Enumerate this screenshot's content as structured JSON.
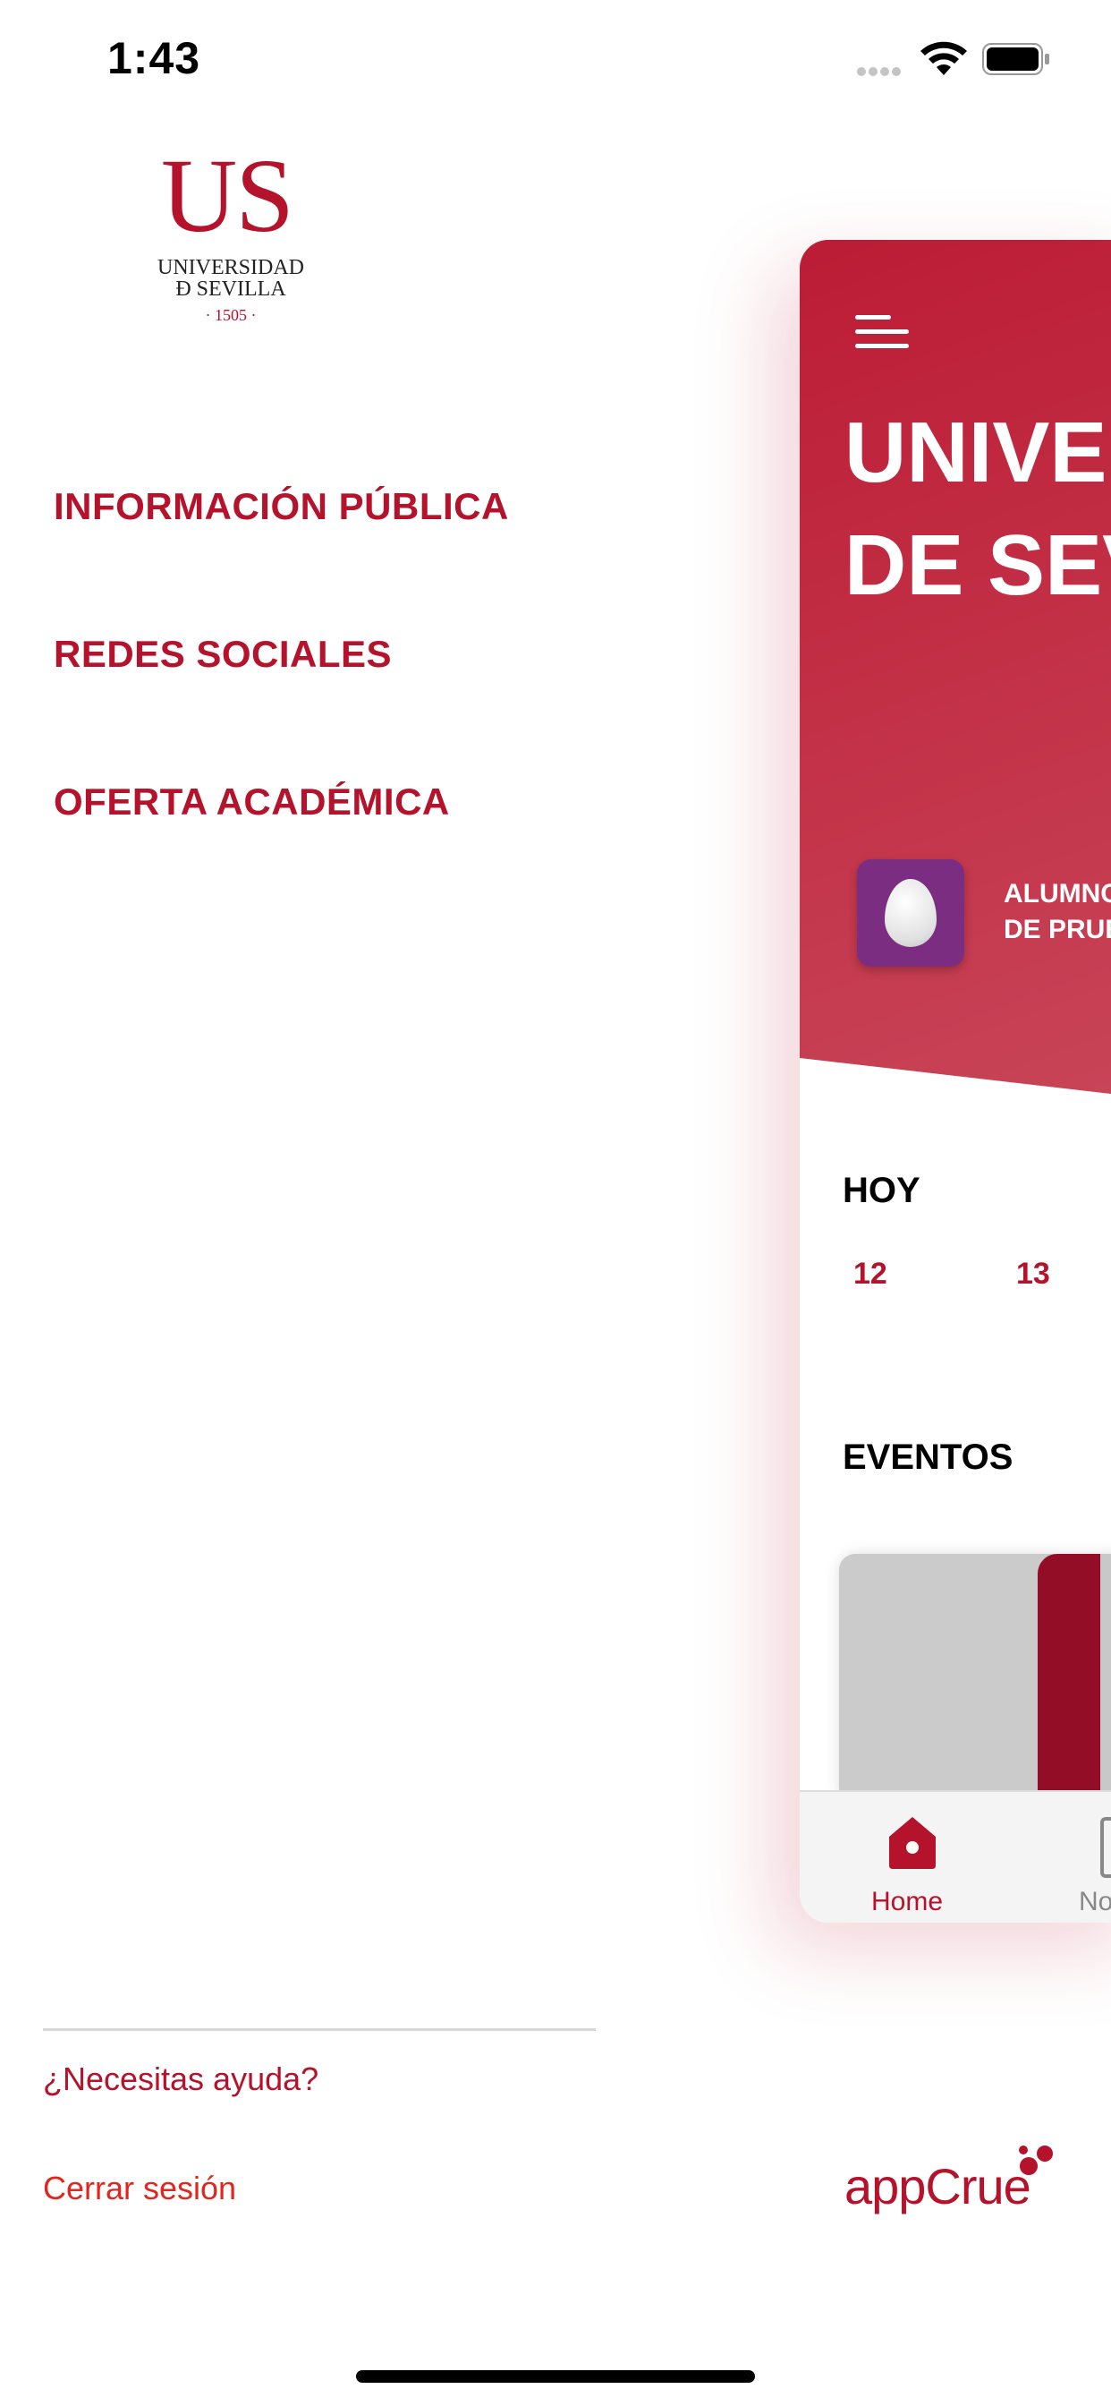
{
  "status_bar": {
    "time": "1:43"
  },
  "logo": {
    "mark": "US",
    "line1": "UNIVERSIDAD",
    "line2": "Ð SEVILLA",
    "year": "· 1505 ·"
  },
  "menu": {
    "items": [
      {
        "label": "INFORMACIÓN PÚBLICA"
      },
      {
        "label": "REDES SOCIALES"
      },
      {
        "label": "OFERTA ACADÉMICA"
      }
    ]
  },
  "footer": {
    "help": "¿Necesitas ayuda?",
    "logout": "Cerrar sesión",
    "brand": "appCrue"
  },
  "preview": {
    "title_line1": "UNIVE",
    "title_line2": "DE SEV",
    "user_line1": "ALUMNC",
    "user_line2": "DE PRUE",
    "today_title": "HOY",
    "days": [
      "12",
      "13"
    ],
    "events_title": "EVENTOS",
    "tabs": [
      {
        "label": "Home",
        "icon": "home-icon"
      },
      {
        "label": "No",
        "icon": "notifications-icon"
      }
    ]
  },
  "colors": {
    "brand_red": "#b5122b",
    "logout_red": "#e0261e",
    "avatar_purple": "#7b2d82"
  }
}
